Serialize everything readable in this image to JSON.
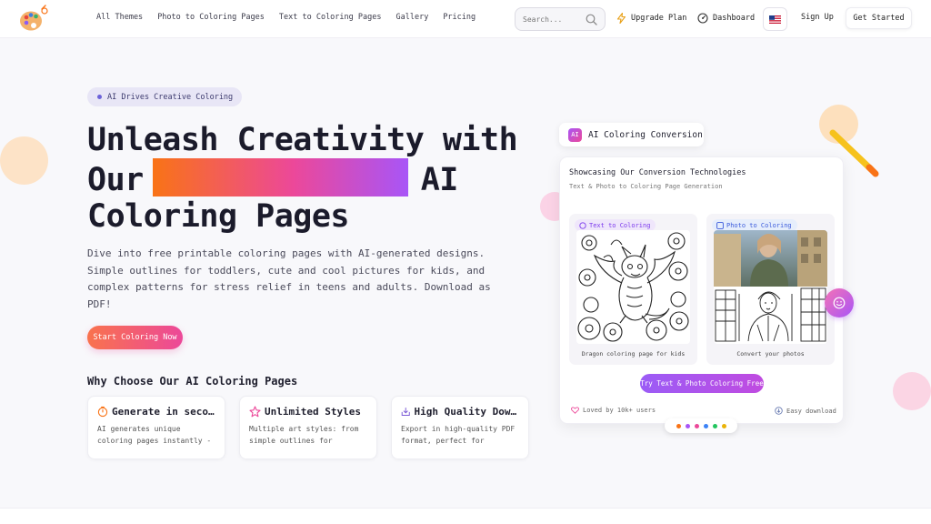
{
  "nav": {
    "links": [
      "All Themes",
      "Photo to Coloring Pages",
      "Text to Coloring Pages",
      "Gallery",
      "Pricing"
    ],
    "search_placeholder": "Search...",
    "upgrade": "Upgrade Plan",
    "dashboard": "Dashboard",
    "sign_up": "Sign Up",
    "get_started": "Get Started"
  },
  "hero": {
    "badge": "AI Drives Creative Coloring",
    "title_line1": "Unleash Creativity with",
    "title_our": "Our",
    "title_ai": "AI",
    "title_line3": "Coloring Pages",
    "description": "Dive into free printable coloring pages with AI-generated designs. Simple outlines for toddlers, cute and cool pictures for kids, and complex patterns for stress relief in teens and adults. Download as PDF!",
    "cta": "Start Coloring Now"
  },
  "why": {
    "title": "Why Choose Our AI Coloring Pages",
    "features": [
      {
        "title": "Generate in seconds",
        "desc": "AI generates unique coloring pages instantly - no waiting required"
      },
      {
        "title": "Unlimited Styles",
        "desc": "Multiple art styles: from simple outlines for toddlers to complex patterns"
      },
      {
        "title": "High Quality Downloads",
        "desc": "Export in high-quality PDF format, perfect for printing at home"
      }
    ]
  },
  "showcase": {
    "pill": "AI Coloring Conversion",
    "pill_chip": "AI",
    "card_title": "Showcasing Our Conversion Technologies",
    "card_sub": "Text & Photo to Coloring Page Generation",
    "text_tag": "Text to Coloring",
    "photo_tag": "Photo to Coloring",
    "text_caption": "Dragon coloring page for kids",
    "photo_caption": "Convert your photos",
    "try_button": "Try Text & Photo Coloring Free",
    "loved": "Loved by 10k+ users",
    "easy": "Easy download"
  },
  "colors": {
    "accent_orange": "#f97316",
    "accent_pink": "#ec4899",
    "accent_purple": "#a855f7",
    "dots": [
      "#f97316",
      "#a855f7",
      "#ec4899",
      "#3b82f6",
      "#22c55e",
      "#eab308"
    ]
  },
  "icons": {
    "upgrade": "lightning-icon",
    "dashboard": "dashboard-icon",
    "flag": "us-flag-icon",
    "search": "search-icon",
    "heart": "heart-icon",
    "download": "download-icon",
    "smile": "smile-icon"
  }
}
